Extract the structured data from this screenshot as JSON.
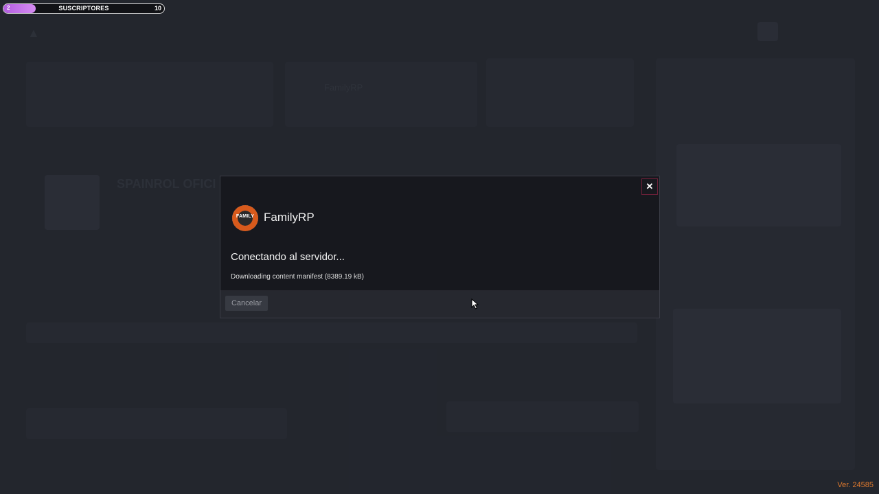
{
  "subscriber_bar": {
    "start": "2",
    "label": "SUSCRIPTORES",
    "goal": "10",
    "progress": 0.2,
    "fill_color": "#c070e8"
  },
  "background": {
    "featured_server": "FamilyRP",
    "server_title": "SPAINROL OFICI"
  },
  "modal": {
    "close_label": "✕",
    "server_logo_text": "FAMILY",
    "server_name": "FamilyRP",
    "status_title": "Conectando al servidor...",
    "status_detail": "Downloading content manifest (8389.19 kB)",
    "cancel_label": "Cancelar"
  },
  "version": "Ver. 24585",
  "icons": {
    "close": "close-icon",
    "cursor": "mouse-cursor-icon",
    "logo": "server-logo-icon"
  }
}
